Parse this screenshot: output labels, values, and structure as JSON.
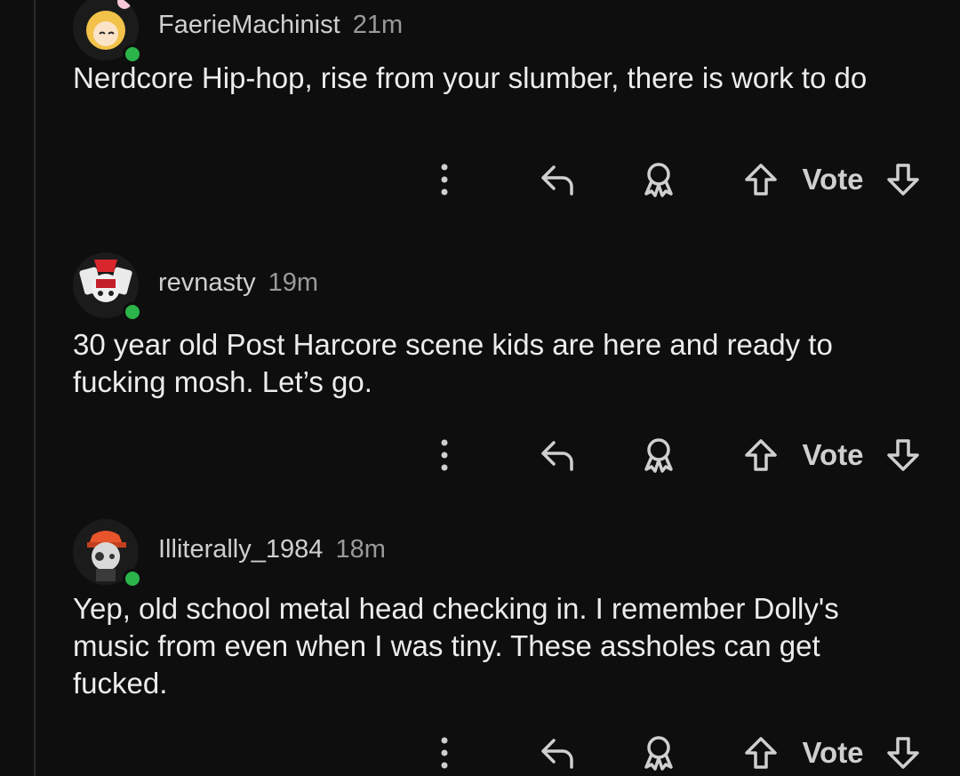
{
  "comments": [
    {
      "username": "FaerieMachinist",
      "time": "21m",
      "text": "Nerdcore Hip-hop, rise from your slumber, there is work to do",
      "vote_label": "Vote"
    },
    {
      "username": "revnasty",
      "time": "19m",
      "text": "30 year old Post Harcore scene kids are here and ready to fucking mosh. Let’s go.",
      "vote_label": "Vote"
    },
    {
      "username": "Illiterally_1984",
      "time": "18m",
      "text": "Yep, old school metal head checking in. I remember Dolly's music from even when I was tiny. These assholes can get fucked.",
      "vote_label": "Vote"
    }
  ],
  "icons": {
    "more": "more-vertical-icon",
    "reply": "reply-arrow-icon",
    "award": "award-ribbon-icon",
    "upvote": "upvote-arrow-icon",
    "downvote": "downvote-arrow-icon"
  },
  "colors": {
    "background": "#0e0e0e",
    "online": "#2bb44a",
    "text": "#ececec",
    "muted": "#9a9a9a"
  }
}
